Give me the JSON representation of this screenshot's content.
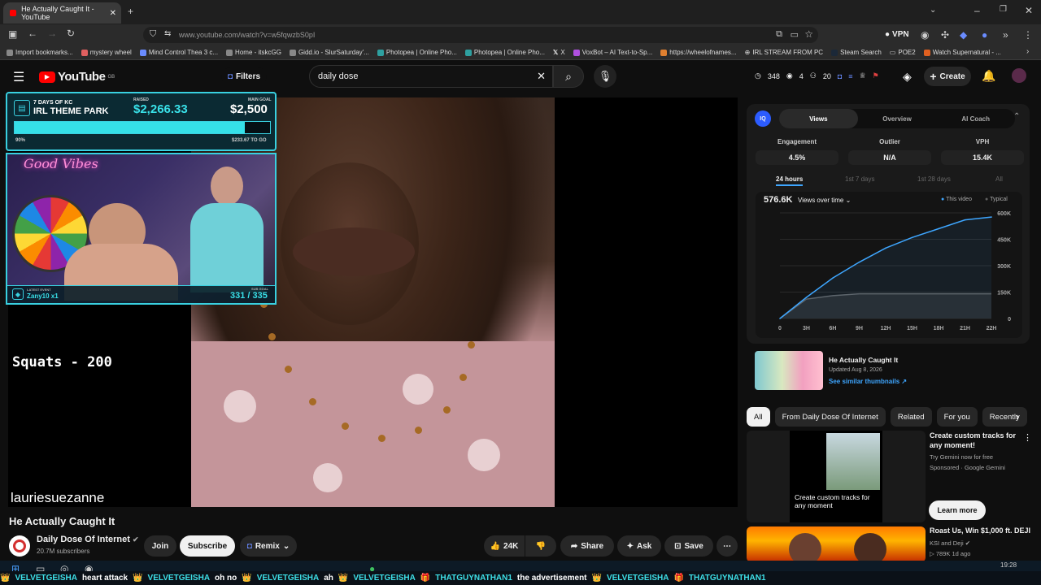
{
  "browser": {
    "tab_title": "He Actually Caught It - YouTube",
    "url": "www.youtube.com/watch?v=w5fqwzbS0pI",
    "vpn_label": "VPN",
    "bookmarks": [
      "Import bookmarks...",
      "mystery wheel",
      "Mind Control Thea 3 c...",
      "Home - itskcGG",
      "Gidd.io - SlurSaturday'...",
      "Photopea | Online Pho...",
      "Photopea | Online Pho...",
      "X",
      "VoxBot – AI Text-to-Sp...",
      "https://wheelofnames...",
      "IRL STREAM FROM PC",
      "Steam Search",
      "POE2",
      "Watch Supernatural - ..."
    ]
  },
  "header": {
    "logo": "YouTube",
    "region": "GB",
    "filters_label": "Filters",
    "search_value": "daily dose",
    "stats": {
      "views": "348",
      "likes": "4",
      "comments": "20"
    },
    "create_label": "Create"
  },
  "overlay": {
    "goal_title_top": "7 DAYS OF KC",
    "goal_title": "IRL THEME PARK",
    "raised_label": "RAISED",
    "raised": "$2,266.33",
    "goal_label": "MAIN GOAL",
    "goal": "$2,500",
    "percent_text": "90%",
    "percent_value": 0.9,
    "remaining": "$233.67 TO GO",
    "neon_text": "Good Vibes",
    "latest_label": "LATEST EVENT",
    "latest_event": "Zany10 x1",
    "sub_label": "SUB GOAL",
    "sub_goal": "331 / 335",
    "squats": "Squats - 200",
    "streamer_name": "lauriesuezanne"
  },
  "video": {
    "title": "He Actually Caught It",
    "channel": "Daily Dose Of Internet",
    "subscribers": "20.7M subscribers",
    "join_label": "Join",
    "subscribe_label": "Subscribe",
    "remix_label": "Remix",
    "likes": "24K",
    "share_label": "Share",
    "ask_label": "Ask",
    "save_label": "Save"
  },
  "vidiq": {
    "tabs": [
      "Views",
      "Overview",
      "AI Coach"
    ],
    "metrics": [
      {
        "label": "Engagement",
        "value": "4.5%"
      },
      {
        "label": "Outlier",
        "value": "N/A"
      },
      {
        "label": "VPH",
        "value": "15.4K"
      }
    ],
    "ranges": [
      "24 hours",
      "1st 7 days",
      "1st 28 days",
      "All"
    ],
    "total_views": "576.6K",
    "views_over_time_label": "Views over time",
    "legend_this": "This video",
    "legend_typical": "Typical",
    "thumb_title": "He Actually Caught It",
    "thumb_updated": "Updated Aug 8, 2026",
    "thumb_link": "See similar thumbnails"
  },
  "chart_data": {
    "type": "line",
    "x": [
      "0",
      "3H",
      "6H",
      "9H",
      "12H",
      "15H",
      "18H",
      "21H",
      "22H"
    ],
    "ylim": [
      0,
      600000
    ],
    "y_ticks": [
      "0",
      "150K",
      "300K",
      "450K",
      "600K"
    ],
    "series": [
      {
        "name": "This video",
        "values": [
          0,
          120000,
          230000,
          320000,
          400000,
          460000,
          510000,
          560000,
          576600
        ]
      },
      {
        "name": "Typical",
        "values": [
          0,
          110000,
          130000,
          140000,
          140000,
          140000,
          140000,
          140000,
          140000
        ]
      }
    ],
    "colors": {
      "this": "#3ea6ff",
      "typical": "#606060"
    }
  },
  "chips": [
    "All",
    "From Daily Dose Of Internet",
    "Related",
    "For you",
    "Recently"
  ],
  "recommendations": [
    {
      "title": "Create custom tracks for any moment!",
      "sub": "Try Gemini now for free",
      "meta": "Sponsored · Google Gemini",
      "thumb_text": "Create custom tracks for any moment",
      "cta": "Learn more"
    },
    {
      "title": "Roast Us, Win $1,000 ft. DEJI",
      "sub": "KSI and Deji",
      "meta": "▷ 789K   1d ago"
    }
  ],
  "taskbar": {
    "time": "19:28"
  },
  "ticker": [
    {
      "user": "VELVETGEISHA",
      "msg": "heart attack"
    },
    {
      "user": "VELVETGEISHA",
      "msg": "oh no"
    },
    {
      "user": "VELVETGEISHA",
      "msg": "ah"
    },
    {
      "user": "VELVETGEISHA",
      "msg": ""
    },
    {
      "user": "THATGUYNATHAN1",
      "msg": "the advertisement"
    },
    {
      "user": "VELVETGEISHA",
      "msg": ""
    },
    {
      "user": "THATGUYNATHAN1",
      "msg": ""
    }
  ]
}
